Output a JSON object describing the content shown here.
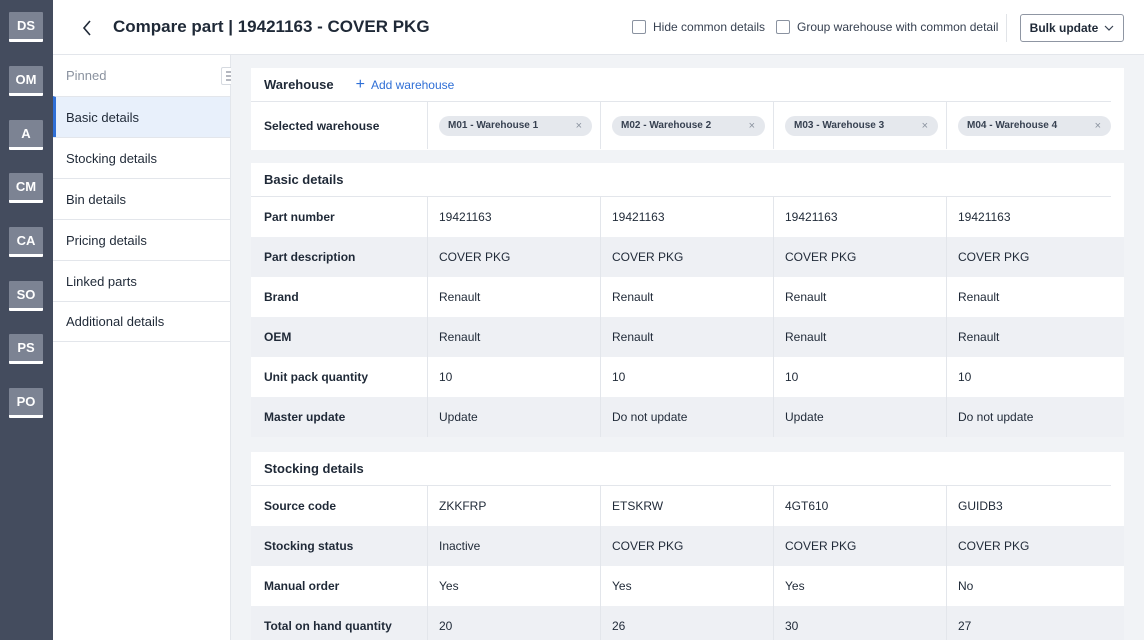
{
  "rail": [
    "DS",
    "OM",
    "A",
    "CM",
    "CA",
    "SO",
    "PS",
    "PO"
  ],
  "header": {
    "title": "Compare part | 19421163 - COVER PKG",
    "hide_common": "Hide common details",
    "group_warehouse": "Group warehouse with common detail",
    "bulk_update": "Bulk update"
  },
  "sidebar": {
    "pinned": "Pinned",
    "items": [
      {
        "label": "Basic details"
      },
      {
        "label": "Stocking details"
      },
      {
        "label": "Bin details"
      },
      {
        "label": "Pricing details"
      },
      {
        "label": "Linked parts"
      },
      {
        "label": "Additional details"
      }
    ]
  },
  "warehouse": {
    "title": "Warehouse",
    "add_label": "Add warehouse",
    "row_label": "Selected warehouse",
    "chips": [
      "M01 - Warehouse 1",
      "M02 - Warehouse 2",
      "M03 - Warehouse 3",
      "M04 - Warehouse 4"
    ]
  },
  "basic": {
    "title": "Basic details",
    "rows": [
      {
        "label": "Part number",
        "values": [
          "19421163",
          "19421163",
          "19421163",
          "19421163"
        ]
      },
      {
        "label": "Part description",
        "values": [
          "COVER PKG",
          "COVER PKG",
          "COVER PKG",
          "COVER PKG"
        ]
      },
      {
        "label": "Brand",
        "values": [
          "Renault",
          "Renault",
          "Renault",
          "Renault"
        ]
      },
      {
        "label": "OEM",
        "values": [
          "Renault",
          "Renault",
          "Renault",
          "Renault"
        ]
      },
      {
        "label": "Unit pack quantity",
        "values": [
          "10",
          "10",
          "10",
          "10"
        ]
      },
      {
        "label": "Master update",
        "values": [
          "Update",
          "Do not update",
          "Update",
          "Do not update"
        ]
      }
    ]
  },
  "stocking": {
    "title": "Stocking details",
    "rows": [
      {
        "label": "Source code",
        "values": [
          "ZKKFRP",
          "ETSKRW",
          "4GT610",
          "GUIDB3"
        ]
      },
      {
        "label": "Stocking status",
        "values": [
          "Inactive",
          "COVER PKG",
          "COVER PKG",
          "COVER PKG"
        ]
      },
      {
        "label": "Manual order",
        "values": [
          "Yes",
          "Yes",
          "Yes",
          "No"
        ]
      },
      {
        "label": "Total on hand quantity",
        "values": [
          "20",
          "26",
          "30",
          "27"
        ]
      }
    ]
  },
  "colors": {
    "accent": "#2f6fd6",
    "rail": "#444c5e",
    "rail_item": "#7c8393",
    "alt_row": "#eef0f4"
  }
}
